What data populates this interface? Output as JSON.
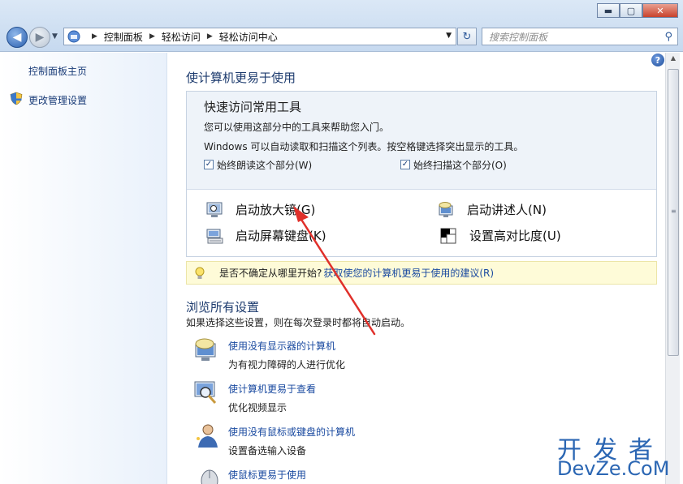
{
  "window": {
    "minimize_glyph": "▬",
    "maximize_glyph": "▢",
    "close_glyph": "✕"
  },
  "address": {
    "breadcrumbs": [
      "控制面板",
      "轻松访问",
      "轻松访问中心"
    ],
    "search_placeholder": "搜索控制面板"
  },
  "sidebar": {
    "items": [
      {
        "label": "控制面板主页"
      },
      {
        "label": "更改管理设置",
        "icon": "shield-icon"
      }
    ]
  },
  "main": {
    "title": "使计算机更易于使用",
    "quick": {
      "title": "快速访问常用工具",
      "line1": "您可以使用这部分中的工具来帮助您入门。",
      "line2": "Windows 可以自动读取和扫描这个列表。按空格键选择突出显示的工具。",
      "checkbox_read": "始终朗读这个部分(W)",
      "checkbox_scan": "始终扫描这个部分(O)",
      "tools": [
        {
          "label": "启动放大镜(G)",
          "icon": "magnifier-icon"
        },
        {
          "label": "启动讲述人(N)",
          "icon": "narrator-icon"
        },
        {
          "label": "启动屏幕键盘(K)",
          "icon": "keyboard-icon"
        },
        {
          "label": "设置高对比度(U)",
          "icon": "contrast-icon"
        }
      ]
    },
    "tip": {
      "text": "是否不确定从哪里开始?",
      "link": "获取使您的计算机更易于使用的建议(R)"
    },
    "browse": {
      "title": "浏览所有设置",
      "desc": "如果选择这些设置，则在每次登录时都将自动启动。",
      "items": [
        {
          "link": "使用没有显示器的计算机",
          "desc": "为有视力障碍的人进行优化"
        },
        {
          "link": "使计算机更易于查看",
          "desc": "优化视频显示"
        },
        {
          "link": "使用没有鼠标或键盘的计算机",
          "desc": "设置备选输入设备"
        },
        {
          "link": "使鼠标更易于使用",
          "desc": ""
        }
      ]
    }
  },
  "watermark": {
    "top": "开发者",
    "bottom": "DevZe.CoM"
  },
  "colors": {
    "link": "#1a4aa0",
    "heading": "#1d3b6e",
    "annotation_arrow": "#e0302a"
  }
}
